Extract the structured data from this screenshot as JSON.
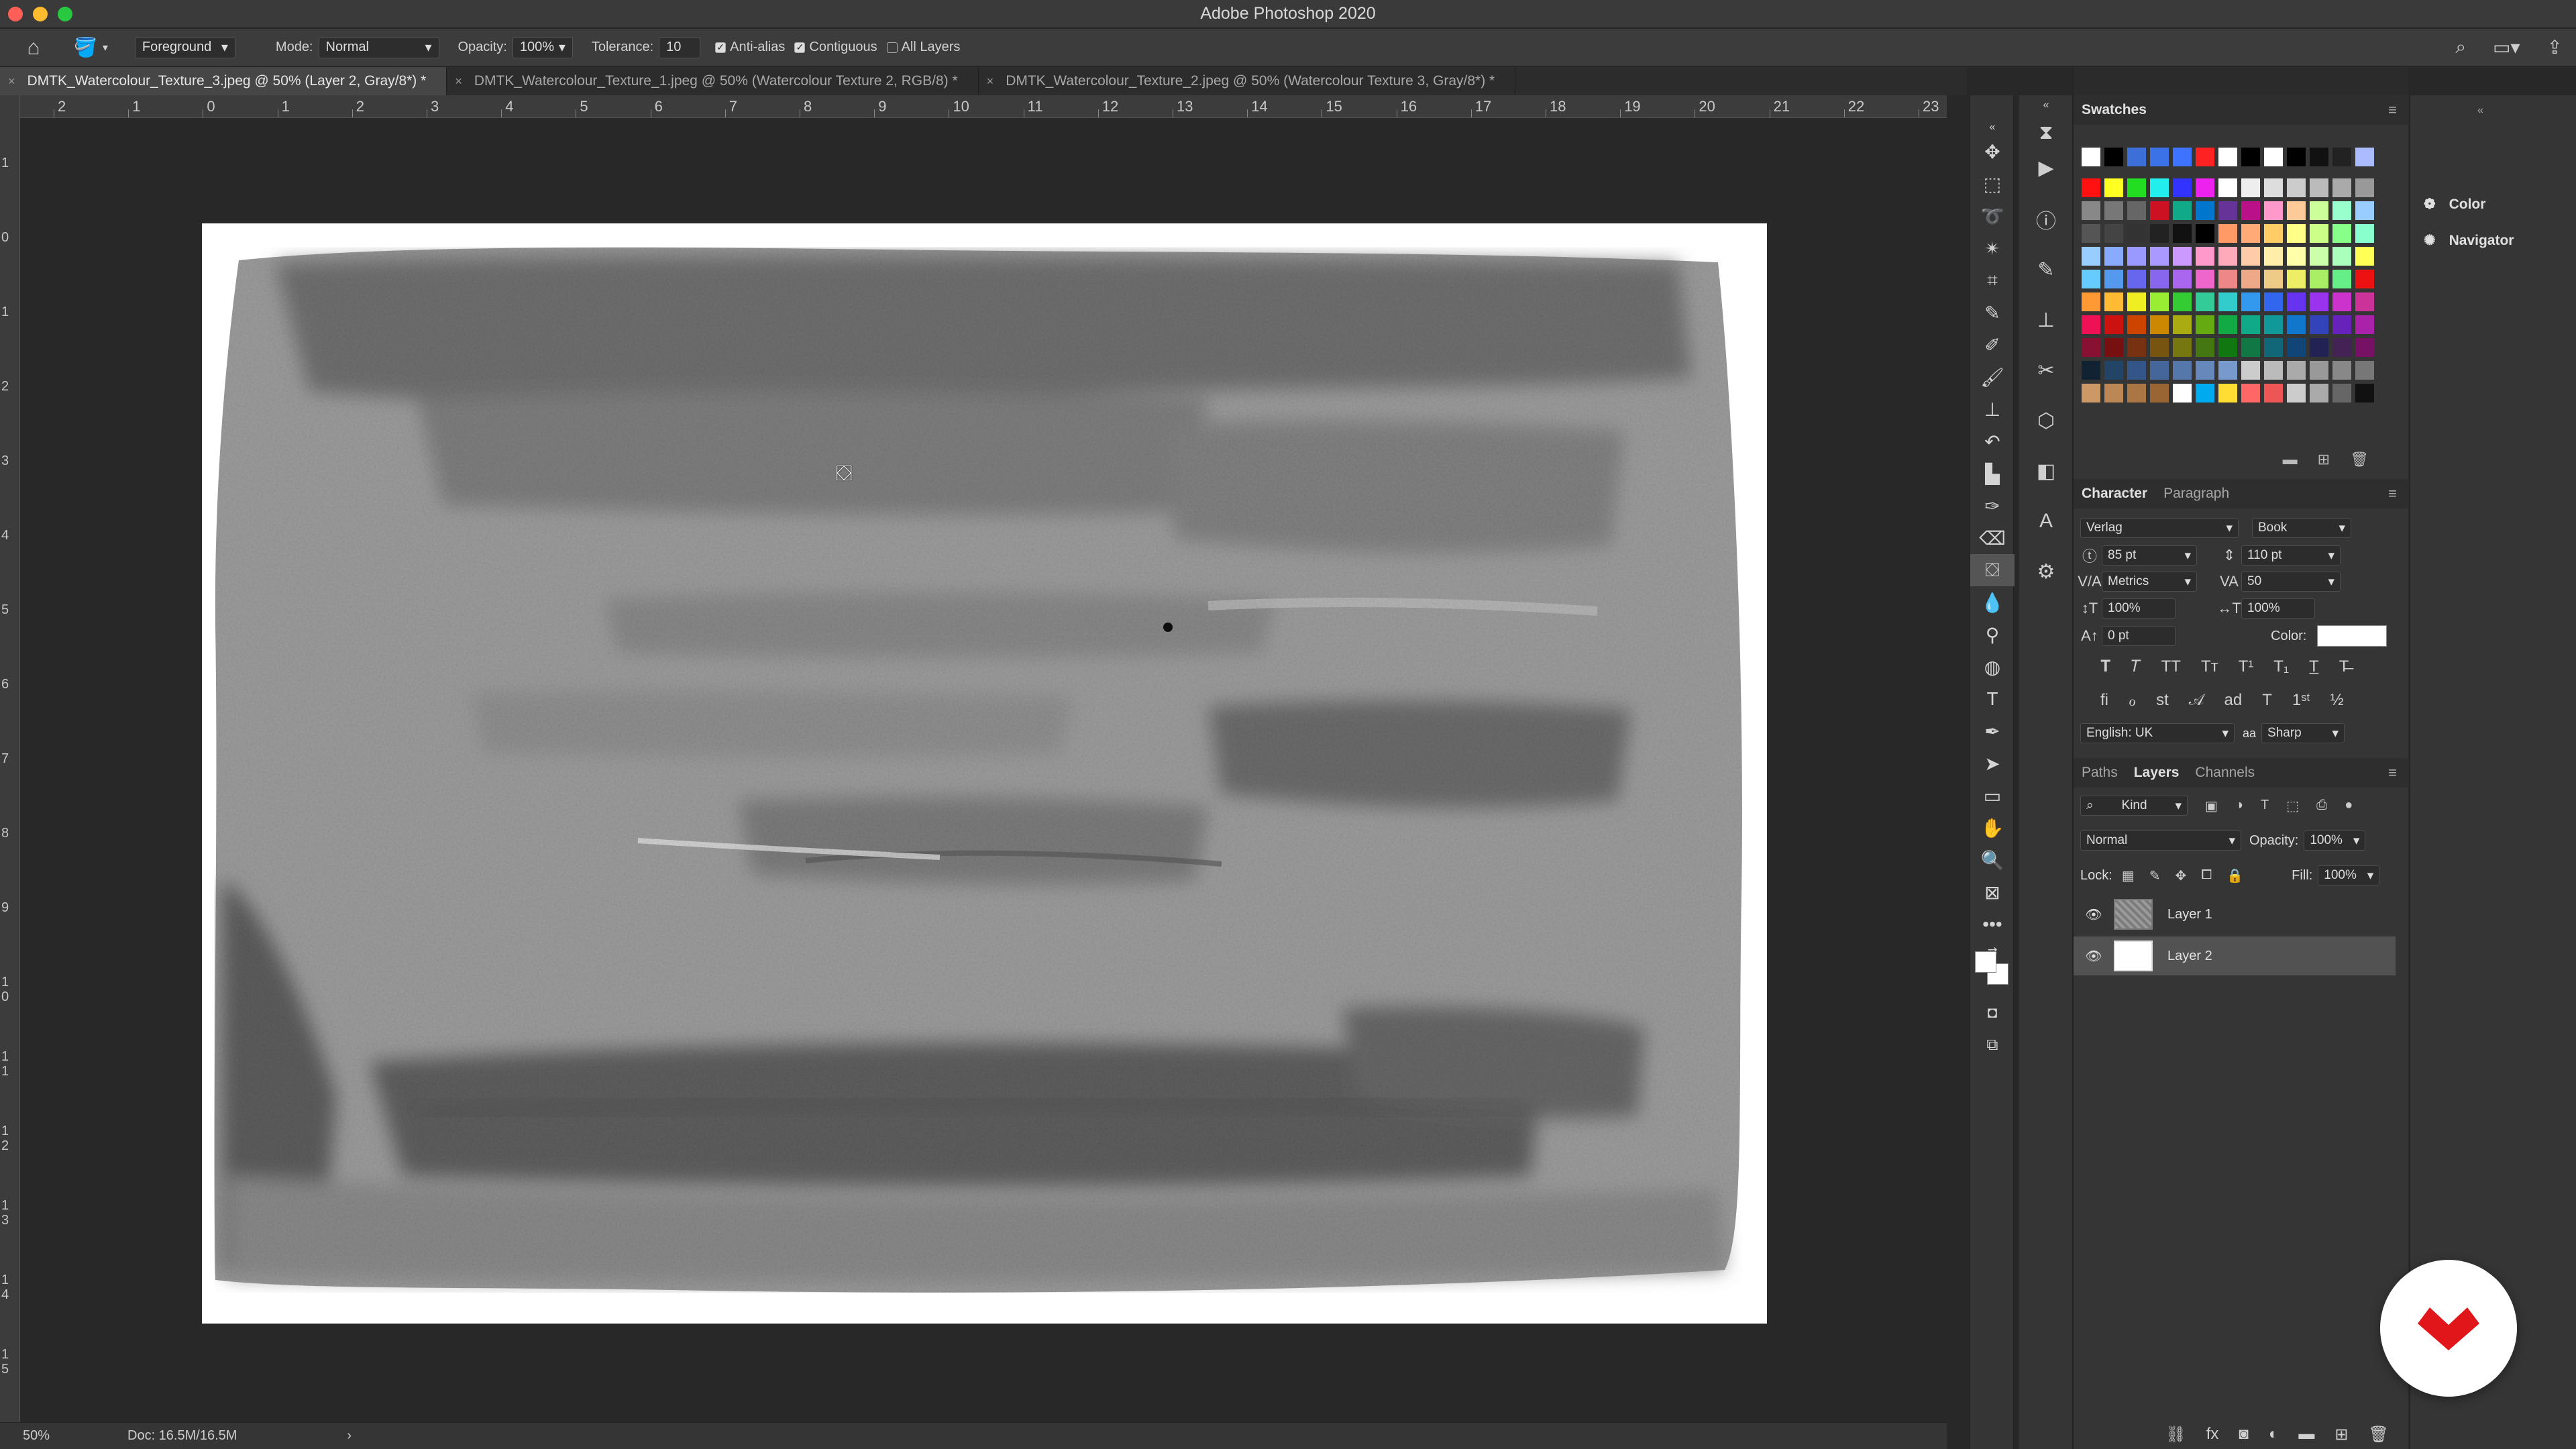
{
  "window": {
    "title": "Adobe Photoshop 2020"
  },
  "options_bar": {
    "fill_source": "Foreground",
    "mode_label": "Mode:",
    "mode_value": "Normal",
    "opacity_label": "Opacity:",
    "opacity_value": "100%",
    "tolerance_label": "Tolerance:",
    "tolerance_value": "10",
    "anti_alias_label": "Anti-alias",
    "contiguous_label": "Contiguous",
    "all_layers_label": "All Layers",
    "anti_alias_checked": true,
    "contiguous_checked": true,
    "all_layers_checked": false
  },
  "tabs": [
    {
      "label": "DMTK_Watercolour_Texture_3.jpeg @ 50% (Layer 2, Gray/8*) *",
      "active": true
    },
    {
      "label": "DMTK_Watercolour_Texture_1.jpeg @ 50% (Watercolour Texture 2, RGB/8) *",
      "active": false
    },
    {
      "label": "DMTK_Watercolour_Texture_2.jpeg @ 50% (Watercolour Texture 3, Gray/8*) *",
      "active": false
    }
  ],
  "ruler": {
    "top": [
      "2",
      "1",
      "0",
      "1",
      "2",
      "3",
      "4",
      "5",
      "6",
      "7",
      "8",
      "9",
      "10",
      "11",
      "12",
      "13",
      "14",
      "15",
      "16",
      "17",
      "18",
      "19",
      "20",
      "21",
      "22",
      "23"
    ],
    "left": [
      "1",
      "0",
      "1",
      "2",
      "3",
      "4",
      "5",
      "6",
      "7",
      "8",
      "9",
      "1 0",
      "1 1",
      "1 2",
      "1 3",
      "1 4",
      "1 5"
    ]
  },
  "status_bar": {
    "zoom": "50%",
    "doc_size": "Doc: 16.5M/16.5M",
    "arrow": "›"
  },
  "panels": {
    "swatches": {
      "title": "Swatches"
    },
    "character": {
      "tab_active": "Character",
      "tab_inactive": "Paragraph",
      "font_family": "Verlag",
      "font_style": "Book",
      "font_size": "85 pt",
      "leading": "110 pt",
      "kerning": "Metrics",
      "tracking": "50",
      "vertical_scale": "100%",
      "horizontal_scale": "100%",
      "baseline_shift": "0 pt",
      "color_label": "Color:",
      "language": "English: UK",
      "aa_label": "aa",
      "antialias": "Sharp",
      "color": "#ffffff"
    },
    "layers": {
      "tab_paths": "Paths",
      "tab_layers": "Layers",
      "tab_channels": "Channels",
      "filter_kind": "Kind",
      "blend_mode": "Normal",
      "opacity_label": "Opacity:",
      "opacity_value": "100%",
      "lock_label": "Lock:",
      "fill_label": "Fill:",
      "fill_value": "100%",
      "items": [
        {
          "name": "Layer 1",
          "selected": false
        },
        {
          "name": "Layer 2",
          "selected": true
        }
      ]
    },
    "collapsed": [
      {
        "label": "Color",
        "icon": "color-wheel-icon"
      },
      {
        "label": "Navigator",
        "icon": "navigator-icon"
      }
    ]
  },
  "colors": {
    "accent_badge": "#e0161b",
    "foreground_color": "#ffffff",
    "background_color": "#ffffff"
  }
}
